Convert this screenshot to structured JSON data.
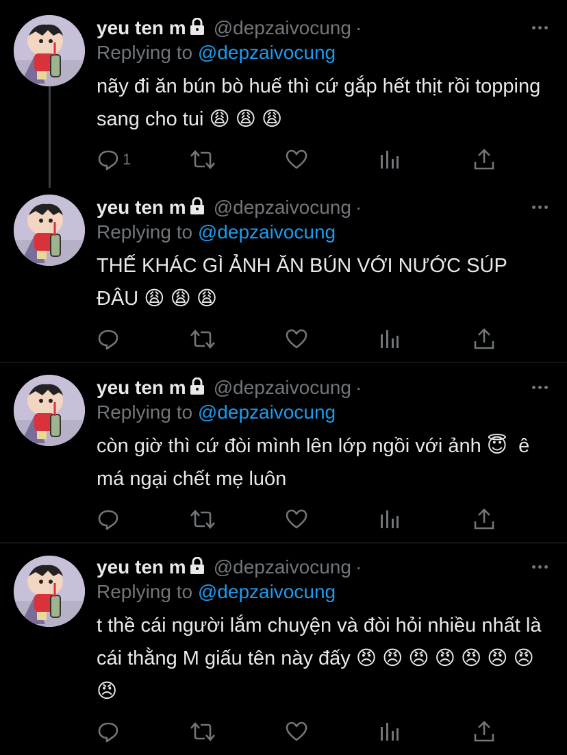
{
  "theme": {
    "background": "#000000",
    "text": "#e7e9ea",
    "muted": "#71767b",
    "link": "#1d9bf0",
    "divider": "#2f3336"
  },
  "tweets": [
    {
      "author_name": "yeu ten m",
      "handle": "@depzaivocung",
      "dot": "·",
      "reply_prefix": "Replying to",
      "reply_to": "@depzaivocung",
      "text": "nãy đi ăn bún bò huế thì cứ gắp hết thịt rồi topping sang cho tui 😩 😩 😩",
      "reply_count": "1"
    },
    {
      "author_name": "yeu ten m",
      "handle": "@depzaivocung",
      "dot": "·",
      "reply_prefix": "Replying to",
      "reply_to": "@depzaivocung",
      "text": "THẾ KHÁC GÌ ẢNH ĂN BÚN VỚI NƯỚC SÚP ĐÂU 😩 😩 😩",
      "reply_count": ""
    },
    {
      "author_name": "yeu ten m",
      "handle": "@depzaivocung",
      "dot": "·",
      "reply_prefix": "Replying to",
      "reply_to": "@depzaivocung",
      "text": "còn giờ thì cứ đòi mình lên lớp ngồi với ảnh 😇  ê má ngại chết mẹ luôn",
      "reply_count": ""
    },
    {
      "author_name": "yeu ten m",
      "handle": "@depzaivocung",
      "dot": "·",
      "reply_prefix": "Replying to",
      "reply_to": "@depzaivocung",
      "text": "t thề cái người lắm chuyện và đòi hỏi nhiều nhất là cái thằng M giấu tên này đấy 😠 😠 😠 😠 😠 😠 😠 😠",
      "reply_count": ""
    }
  ],
  "icons": {
    "lock": "lock-icon",
    "more": "more-icon",
    "reply": "reply-icon",
    "retweet": "retweet-icon",
    "like": "heart-icon",
    "analytics": "analytics-icon",
    "share": "share-icon"
  }
}
